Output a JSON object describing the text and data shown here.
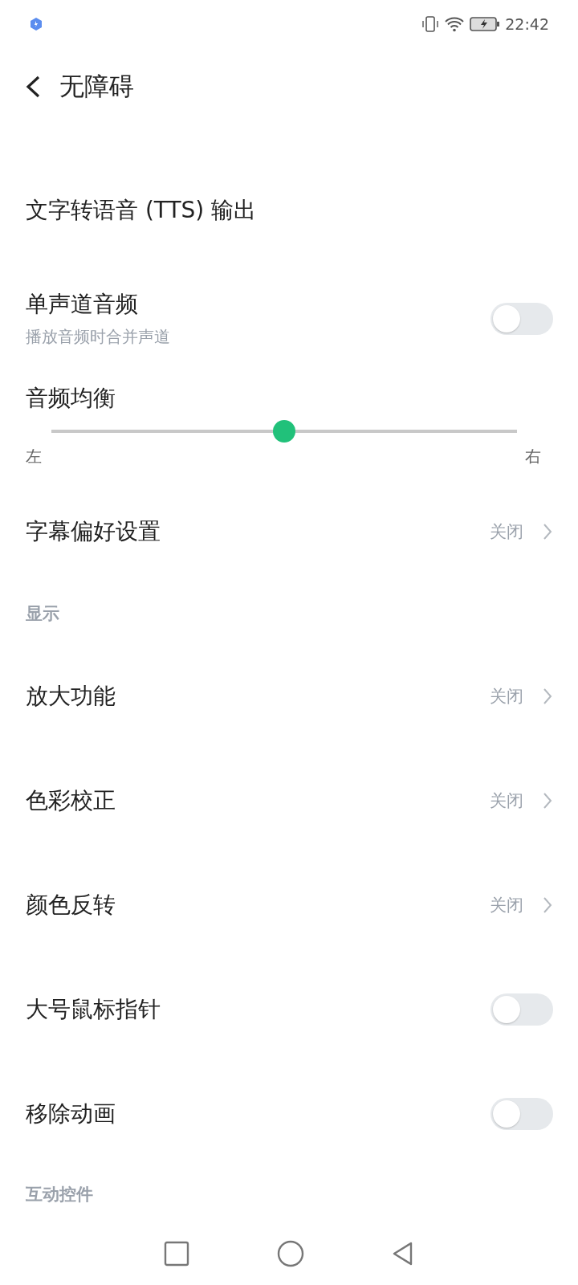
{
  "status_bar": {
    "time": "22:42"
  },
  "header": {
    "title": "无障碍"
  },
  "items": [
    {
      "kind": "link",
      "label": "文字转语音 (TTS) 输出"
    },
    {
      "kind": "toggle",
      "label": "单声道音频",
      "subtitle": "播放音频时合并声道",
      "on": false
    },
    {
      "kind": "slider",
      "label": "音频均衡",
      "level": 0.5,
      "min_label": "左",
      "max_label": "右"
    },
    {
      "kind": "link",
      "label": "字幕偏好设置",
      "value": "关闭"
    },
    {
      "kind": "header",
      "label": "显示"
    },
    {
      "kind": "link",
      "label": "放大功能",
      "value": "关闭"
    },
    {
      "kind": "link",
      "label": "色彩校正",
      "value": "关闭"
    },
    {
      "kind": "link",
      "label": "颜色反转",
      "value": "关闭"
    },
    {
      "kind": "toggle",
      "label": "大号鼠标指针",
      "on": false
    },
    {
      "kind": "toggle",
      "label": "移除动画",
      "on": false
    },
    {
      "kind": "header",
      "label": "互动控件"
    }
  ]
}
